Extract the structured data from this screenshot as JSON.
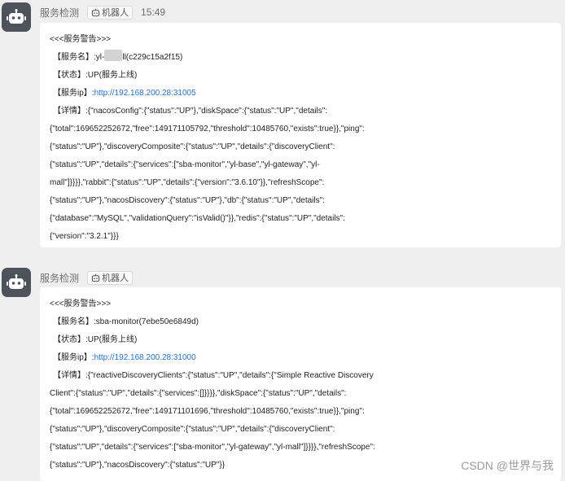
{
  "messages": [
    {
      "sender": "服务检测",
      "bot_tag": "机器人",
      "time": "15:49",
      "header": "<<<服务警告>>>",
      "service_label": "【服务名】:",
      "service_name_prefix": "yl-",
      "service_name_suffix": "ll(c229c15a2f15)",
      "status_label": "【状态】:",
      "status_value": "UP(服务上线)",
      "ip_label": "【服务ip】:",
      "ip_value": "http://192.168.200.28:31005",
      "detail_label": "【详情】:",
      "detail_lines": [
        "{\"nacosConfig\":{\"status\":\"UP\"},\"diskSpace\":{\"status\":\"UP\",\"details\":",
        "{\"total\":169652252672,\"free\":149171105792,\"threshold\":10485760,\"exists\":true}},\"ping\":",
        "{\"status\":\"UP\"},\"discoveryComposite\":{\"status\":\"UP\",\"details\":{\"discoveryClient\":",
        "{\"status\":\"UP\",\"details\":{\"services\":[\"sba-monitor\",\"yl-base\",\"yl-gateway\",\"yl-",
        "mall\"]}}}},\"rabbit\":{\"status\":\"UP\",\"details\":{\"version\":\"3.6.10\"}},\"refreshScope\":",
        "{\"status\":\"UP\"},\"nacosDiscovery\":{\"status\":\"UP\"},\"db\":{\"status\":\"UP\",\"details\":",
        "{\"database\":\"MySQL\",\"validationQuery\":\"isValid()\"}},\"redis\":{\"status\":\"UP\",\"details\":",
        "{\"version\":\"3.2.1\"}}}"
      ]
    },
    {
      "sender": "服务检测",
      "bot_tag": "机器人",
      "time": "",
      "header": "<<<服务警告>>>",
      "service_label": "【服务名】:",
      "service_name": "sba-monitor(7ebe50e6849d)",
      "status_label": "【状态】:",
      "status_value": "UP(服务上线)",
      "ip_label": "【服务ip】:",
      "ip_value": "http://192.168.200.28:31000",
      "detail_label": "【详情】:",
      "detail_lines": [
        "{\"reactiveDiscoveryClients\":{\"status\":\"UP\",\"details\":{\"Simple Reactive Discovery",
        "Client\":{\"status\":\"UP\",\"details\":{\"services\":[]}}}},\"diskSpace\":{\"status\":\"UP\",\"details\":",
        "{\"total\":169652252672,\"free\":149171101696,\"threshold\":10485760,\"exists\":true}},\"ping\":",
        "{\"status\":\"UP\"},\"discoveryComposite\":{\"status\":\"UP\",\"details\":{\"discoveryClient\":",
        "{\"status\":\"UP\",\"details\":{\"services\":[\"sba-monitor\",\"yl-gateway\",\"yl-mall\"]}}}},\"refreshScope\":",
        "{\"status\":\"UP\"},\"nacosDiscovery\":{\"status\":\"UP\"}}"
      ]
    }
  ],
  "watermark": "CSDN @世界与我"
}
